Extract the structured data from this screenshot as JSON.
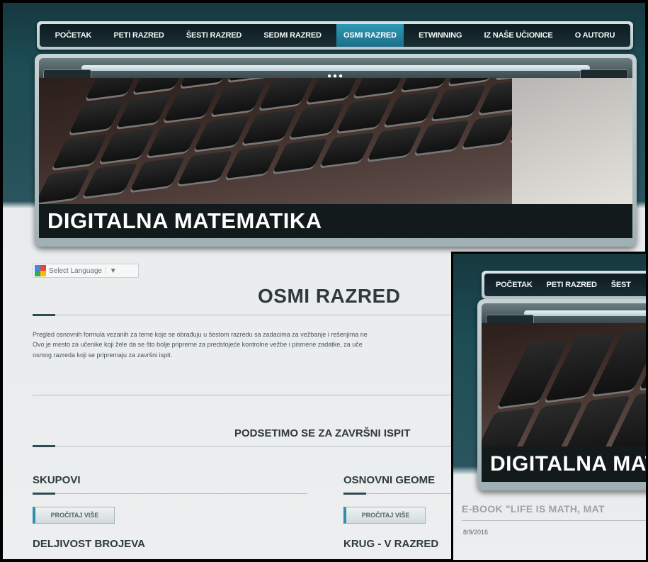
{
  "nav": {
    "items": [
      {
        "label": "POČETAK"
      },
      {
        "label": "PETI RAZRED"
      },
      {
        "label": "ŠESTI RAZRED"
      },
      {
        "label": "SEDMI RAZRED"
      },
      {
        "label": "OSMI RAZRED",
        "active": true
      },
      {
        "label": "ETWINNING"
      },
      {
        "label": "IZ NAŠE UČIONICE"
      },
      {
        "label": "O AUTORU"
      }
    ]
  },
  "banner": {
    "title": "DIGITALNA MATEMATIKA"
  },
  "language": {
    "label": "Select Language",
    "arrow": "▼",
    "icon": "google-translate-icon"
  },
  "page": {
    "title": "OSMI RAZRED",
    "intro": [
      "Pregled osnovnih formula vezanih za teme koje se obrađuju u šestom razredu sa zadacima za vežbanje i rešenjima ne",
      "Ovo je mesto za učenike koji žele da se što bolje pripreme za predstojeće kontrolne vežbe i pismene zadatke, za uče",
      "osmog razreda koji se pripremaju za završni ispit."
    ],
    "section_title": "PODSETIMO SE ZA ZAVRŠNI ISPIT",
    "cards": [
      {
        "title": "SKUPOVI",
        "button": "PROČITAJ VIŠE"
      },
      {
        "title": "OSNOVNI GEOME",
        "button": "PROČITAJ VIŠE"
      },
      {
        "title": "DELJIVOST BROJEVA"
      },
      {
        "title": "KRUG - V RAZRED"
      }
    ]
  },
  "inset": {
    "nav": [
      {
        "label": "POČETAK"
      },
      {
        "label": "PETI RAZRED"
      },
      {
        "label": "ŠEST"
      }
    ],
    "banner_title": "DIGITALNA MAT",
    "post_title": "E-BOOK \"LIFE IS MATH, MAT",
    "post_date": "8/9/2016"
  },
  "colors": {
    "accent": "#2e98b6",
    "nav_bg": "#0d1d22",
    "title_text": "#2e3a3d"
  }
}
